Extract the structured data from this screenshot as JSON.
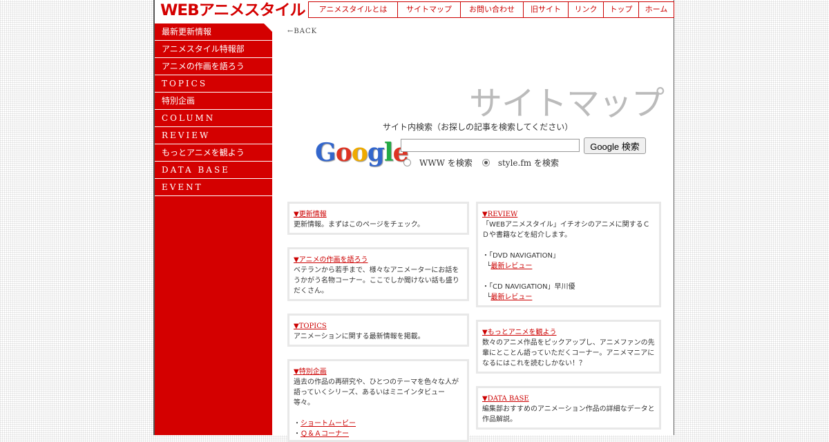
{
  "logo": "WEBアニメスタイル",
  "topnav": [
    {
      "label": "アニメスタイルとは",
      "w": 128
    },
    {
      "label": "サイトマップ",
      "w": 90
    },
    {
      "label": "お問い合わせ",
      "w": 90
    },
    {
      "label": "旧サイト",
      "w": 64
    },
    {
      "label": "リンク",
      "w": 50
    },
    {
      "label": "トップ",
      "w": 50
    },
    {
      "label": "ホーム",
      "w": 50
    }
  ],
  "sidebar": {
    "items": [
      {
        "label": "最新更新情報",
        "spaced": false
      },
      {
        "label": "アニメスタイル特報部",
        "spaced": false
      },
      {
        "label": "アニメの作画を語ろう",
        "spaced": false
      },
      {
        "label": "TOPICS",
        "spaced": true
      },
      {
        "label": "特別企画",
        "spaced": false
      },
      {
        "label": "COLUMN",
        "spaced": true
      },
      {
        "label": "REVIEW",
        "spaced": true
      },
      {
        "label": "もっとアニメを観よう",
        "spaced": false
      },
      {
        "label": "DATA BASE",
        "spaced": true
      },
      {
        "label": "EVENT",
        "spaced": true
      }
    ]
  },
  "back": "←BACK",
  "page_title": "サイトマップ",
  "search": {
    "caption": "サイト内検索（お探しの記事を検索してください）",
    "logo_letters": [
      {
        "ch": "G",
        "color": "#3366cc"
      },
      {
        "ch": "o",
        "color": "#dd3322"
      },
      {
        "ch": "o",
        "color": "#eeaa00"
      },
      {
        "ch": "g",
        "color": "#3366cc"
      },
      {
        "ch": "l",
        "color": "#22aa44"
      },
      {
        "ch": "e",
        "color": "#dd3322"
      }
    ],
    "value": "",
    "button": "Google 検索",
    "opt_www": "WWW を検索",
    "opt_site": "style.fm を検索"
  },
  "boxes": {
    "koshin": {
      "title": "▼更新情報",
      "text": "更新情報。まずはこのページをチェック。"
    },
    "sakuga": {
      "title": "▼アニメの作画を語ろう",
      "text": "ベテランから若手まで、様々なアニメーターにお話をうかがう名物コーナー。ここでしか聞けない話も盛りだくさん。"
    },
    "topics": {
      "title": "▼TOPICS",
      "text": "アニメーションに関する最新情報を掲載。"
    },
    "tokubetsu": {
      "title": "▼特別企画",
      "text": "過去の作品の再研究や、ひとつのテーマを色々な人が語っていくシリーズ、あるいはミニインタビュー等々。",
      "links": [
        "ショートムービー",
        "Ｑ＆Ａコーナー"
      ]
    },
    "review": {
      "title": "▼REVIEW",
      "text": "「WEBアニメスタイル」イチオシのアニメに関するＣＤや書籍などを紹介します。",
      "dvd": "「DVD NAVIGATION」",
      "cd": "「CD NAVIGATION」早川優",
      "latest": "最新レビュー"
    },
    "motto": {
      "title": "▼もっとアニメを観よう",
      "text": "数々のアニメ作品をピックアップし、アニメファンの先輩にとことん語っていただくコーナー。アニメマニアになるにはこれを読むしかない！？"
    },
    "database": {
      "title": "▼DATA BASE",
      "text": "編集部おすすめのアニメーション作品の詳細なデータと作品解説。"
    }
  }
}
